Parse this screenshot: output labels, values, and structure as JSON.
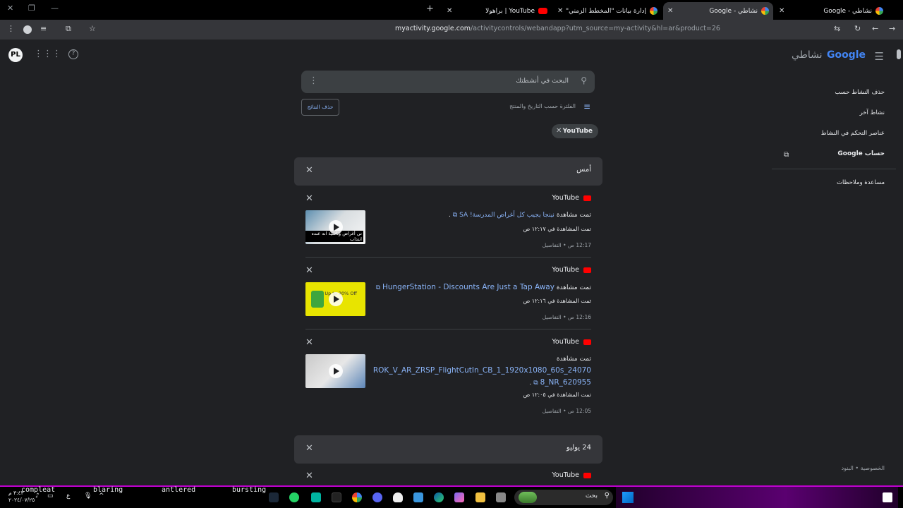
{
  "tabs": [
    {
      "title": "نشاطي - Google",
      "favicon": "google-icon",
      "active": false
    },
    {
      "title": "نشاطي - Google",
      "favicon": "google-icon",
      "active": true
    },
    {
      "title": "إدارة بيانات \"المخطط الزمني\" - ...",
      "favicon": "google-icon",
      "active": false
    },
    {
      "title": "YouTube | براهولا",
      "favicon": "youtube-icon",
      "active": false
    }
  ],
  "toolbar": {
    "url_domain": "myactivity.google.com",
    "url_rest": "/activitycontrols/webandapp?utm_source=my-activity&hl=ar&product=26"
  },
  "header": {
    "logo_word": "Google",
    "logo_sub": "نشاطي",
    "avatar_text": "PL"
  },
  "sidebar": {
    "items": [
      {
        "label": "حذف النشاط حسب"
      },
      {
        "label": "نشاط آخر"
      },
      {
        "label": "عناصر التحكم في النشاط"
      },
      {
        "label": "حساب Google"
      },
      {
        "label": "مساعدة وملاحظات"
      }
    ],
    "footer": "الخصوصية • البنود"
  },
  "search": {
    "placeholder": "البحث في أنشطتك"
  },
  "filter": {
    "label": "الفلترة حسب التاريخ والمنتج",
    "delete_results": "حذف النتائج",
    "chip": "YouTube"
  },
  "groups": [
    {
      "day": "أمس",
      "items": [
        {
          "product": "YouTube",
          "prefix": "تمت مشاهدة",
          "title": "نينجا يجيب كل أغراض المدرسة! SA",
          "watched_at": "تمت المشاهدة في ١٢:١٧ ص",
          "meta": "12:17 ص • التفاصيل",
          "thumb_caption": "ني أغراض وناسية انه عنده انتداب"
        },
        {
          "product": "YouTube",
          "prefix": "تمت مشاهدة",
          "title": "HungerStation - Discounts Are Just a Tap Away",
          "watched_at": "تمت المشاهدة في ١٢:١٦ ص",
          "meta": "12:16 ص • التفاصيل",
          "thumb_caption": "Up to 30% Off"
        },
        {
          "product": "YouTube",
          "prefix": "تمت مشاهدة",
          "title": "ROK_V_AR_ZRSP_FlightCutIn_CB_1_1920x1080_60s_240708_NR_620955",
          "watched_at": "تمت المشاهدة في ١٢:٠٥ ص",
          "meta": "12:05 ص • التفاصيل",
          "thumb_caption": ""
        }
      ]
    },
    {
      "day": "24 يوليو",
      "items": [
        {
          "product": "YouTube"
        }
      ]
    }
  ],
  "taskbar": {
    "words": [
      "compleat",
      "blaring",
      "antlered",
      "bursting"
    ],
    "clock_time": "٣:٤٣ م",
    "clock_date": "٢٠٢٤/٠٧/٢٥",
    "lang": "ع",
    "search_label": "بحث"
  },
  "colors": {
    "background": "#202124",
    "link": "#8ab4f8",
    "youtube_red": "#ff0000",
    "taskbar_accent": "#c000d0"
  }
}
